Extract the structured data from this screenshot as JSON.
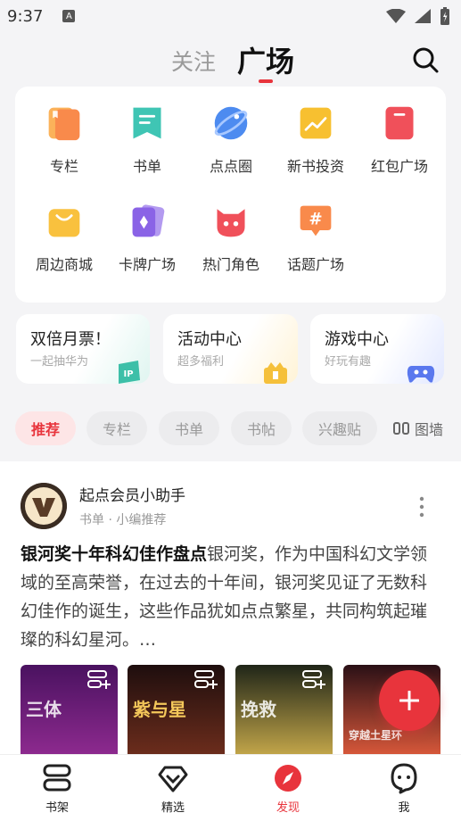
{
  "status": {
    "time": "9:37",
    "a_glyph": "A"
  },
  "header": {
    "tab_follow": "关注",
    "tab_square": "广场"
  },
  "grid": {
    "items": [
      {
        "label": "专栏",
        "icon": "column-icon",
        "color": "#f98a4b"
      },
      {
        "label": "书单",
        "icon": "booklist-icon",
        "color": "#3fc5b4"
      },
      {
        "label": "点点圈",
        "icon": "planet-icon",
        "color": "#4d8bf0"
      },
      {
        "label": "新书投资",
        "icon": "invest-icon",
        "color": "#f7c030"
      },
      {
        "label": "红包广场",
        "icon": "redpacket-icon",
        "color": "#f0505a"
      },
      {
        "label": "周边商城",
        "icon": "shopping-bag-icon",
        "color": "#f9c13e"
      },
      {
        "label": "卡牌广场",
        "icon": "cards-icon",
        "color": "#8a63e6"
      },
      {
        "label": "热门角色",
        "icon": "character-icon",
        "color": "#f0505a"
      },
      {
        "label": "话题广场",
        "icon": "topic-hash-icon",
        "color": "#f98a4b"
      }
    ]
  },
  "promos": [
    {
      "title": "双倍月票！",
      "subtitle": "一起抽华为",
      "badge": "IP"
    },
    {
      "title": "活动中心",
      "subtitle": "超多福利",
      "badge": ""
    },
    {
      "title": "游戏中心",
      "subtitle": "好玩有趣",
      "badge": ""
    }
  ],
  "chips": {
    "items": [
      {
        "label": "推荐",
        "active": true
      },
      {
        "label": "专栏",
        "active": false
      },
      {
        "label": "书单",
        "active": false
      },
      {
        "label": "书帖",
        "active": false
      },
      {
        "label": "兴趣贴",
        "active": false
      }
    ],
    "wall_label": "图墙"
  },
  "post": {
    "author": "起点会员小助手",
    "meta": "书单 · 小编推荐",
    "title": "银河奖十年科幻佳作盘点",
    "body": "银河奖，作为中国科幻文学领域的至高荣誉，在过去的十年间，银河奖见证了无数科幻佳作的诞生，这些作品犹如点点繁星，共同构筑起璀璨的科幻星河。…",
    "covers": [
      {
        "text": "三体",
        "color": "#6a1c7a"
      },
      {
        "text": "紫与星",
        "color": "#3a1a16"
      },
      {
        "text": "挽救",
        "color": "#23281f"
      },
      {
        "text": "穿越土星环",
        "color": "#c0412a"
      }
    ]
  },
  "nav": {
    "items": [
      {
        "label": "书架",
        "active": false
      },
      {
        "label": "精选",
        "active": false
      },
      {
        "label": "发现",
        "active": true
      },
      {
        "label": "我",
        "active": false
      }
    ]
  },
  "colors": {
    "accent": "#e8343c"
  }
}
